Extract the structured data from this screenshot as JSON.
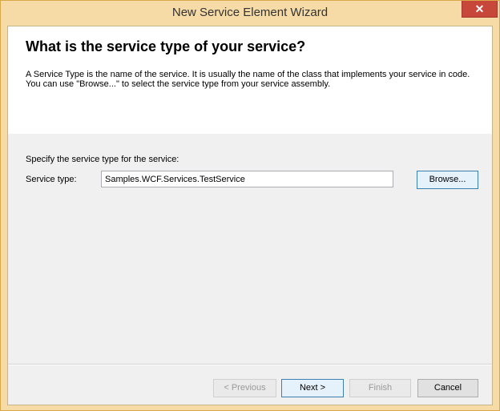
{
  "window": {
    "title": "New Service Element Wizard",
    "close_glyph": "✕"
  },
  "header": {
    "heading": "What is the service type of your service?",
    "description": "A Service Type is the name of the service. It is usually the name of the class that implements your service in code. You can use \"Browse...\" to select the service type from your service assembly."
  },
  "form": {
    "prompt": "Specify the service type for the service:",
    "service_type_label": "Service type:",
    "service_type_value": "Samples.WCF.Services.TestService",
    "browse_label": "Browse..."
  },
  "buttons": {
    "previous": "< Previous",
    "next": "Next >",
    "finish": "Finish",
    "cancel": "Cancel"
  },
  "colors": {
    "titlebar": "#f6dba6",
    "close_button": "#c7473b",
    "client_background": "#f0f0f0",
    "header_background": "#ffffff"
  }
}
